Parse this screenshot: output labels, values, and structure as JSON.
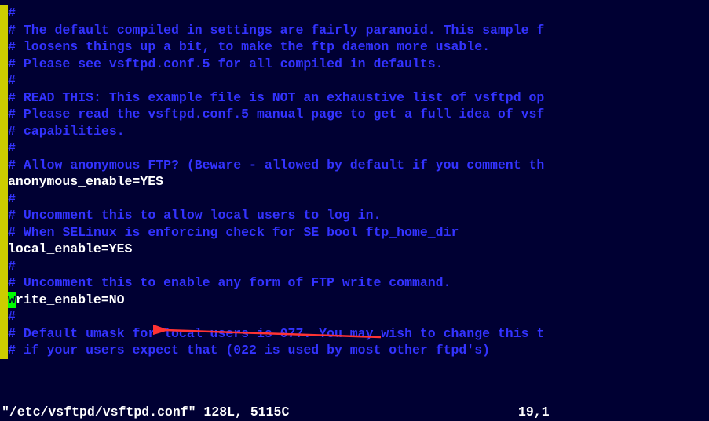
{
  "lines": [
    {
      "gutter": true,
      "hash": "#",
      "type": "comment",
      "text": ""
    },
    {
      "gutter": true,
      "hash": "#",
      "type": "comment",
      "text": " The default compiled in settings are fairly paranoid. This sample f"
    },
    {
      "gutter": true,
      "hash": "#",
      "type": "comment",
      "text": " loosens things up a bit, to make the ftp daemon more usable."
    },
    {
      "gutter": true,
      "hash": "#",
      "type": "comment",
      "text": " Please see vsftpd.conf.5 for all compiled in defaults."
    },
    {
      "gutter": true,
      "hash": "#",
      "type": "comment",
      "text": ""
    },
    {
      "gutter": true,
      "hash": "#",
      "type": "comment",
      "text": " READ THIS: This example file is NOT an exhaustive list of vsftpd op"
    },
    {
      "gutter": true,
      "hash": "#",
      "type": "comment",
      "text": " Please read the vsftpd.conf.5 manual page to get a full idea of vsf"
    },
    {
      "gutter": true,
      "hash": "#",
      "type": "comment",
      "text": " capabilities."
    },
    {
      "gutter": true,
      "hash": "#",
      "type": "comment",
      "text": ""
    },
    {
      "gutter": true,
      "hash": "#",
      "type": "comment",
      "text": " Allow anonymous FTP? (Beware - allowed by default if you comment th"
    },
    {
      "gutter": true,
      "hash": "",
      "type": "setting",
      "first": "a",
      "rest": "nonymous_enable=YES"
    },
    {
      "gutter": true,
      "hash": "#",
      "type": "comment",
      "text": ""
    },
    {
      "gutter": true,
      "hash": "#",
      "type": "comment",
      "text": " Uncomment this to allow local users to log in."
    },
    {
      "gutter": true,
      "hash": "#",
      "type": "comment",
      "text": " When SELinux is enforcing check for SE bool ftp_home_dir"
    },
    {
      "gutter": true,
      "hash": "",
      "type": "setting",
      "first": "l",
      "rest": "ocal_enable=YES"
    },
    {
      "gutter": true,
      "hash": "#",
      "type": "comment",
      "text": ""
    },
    {
      "gutter": true,
      "hash": "#",
      "type": "comment",
      "text": " Uncomment this to enable any form of FTP write command."
    },
    {
      "gutter": true,
      "hash": "",
      "type": "setting-cursor",
      "first": "w",
      "rest": "rite_enable=NO"
    },
    {
      "gutter": true,
      "hash": "#",
      "type": "comment",
      "text": ""
    },
    {
      "gutter": true,
      "hash": "#",
      "type": "comment",
      "text": " Default umask for local users is 077. You may wish to change this t"
    },
    {
      "gutter": true,
      "hash": "#",
      "type": "comment",
      "text": " if your users expect that (022 is used by most other ftpd's)"
    }
  ],
  "status": {
    "file": "\"/etc/vsftpd/vsftpd.conf\" 128L, 5115C",
    "pos": "19,1"
  },
  "arrow": {
    "color": "#ff3333"
  }
}
